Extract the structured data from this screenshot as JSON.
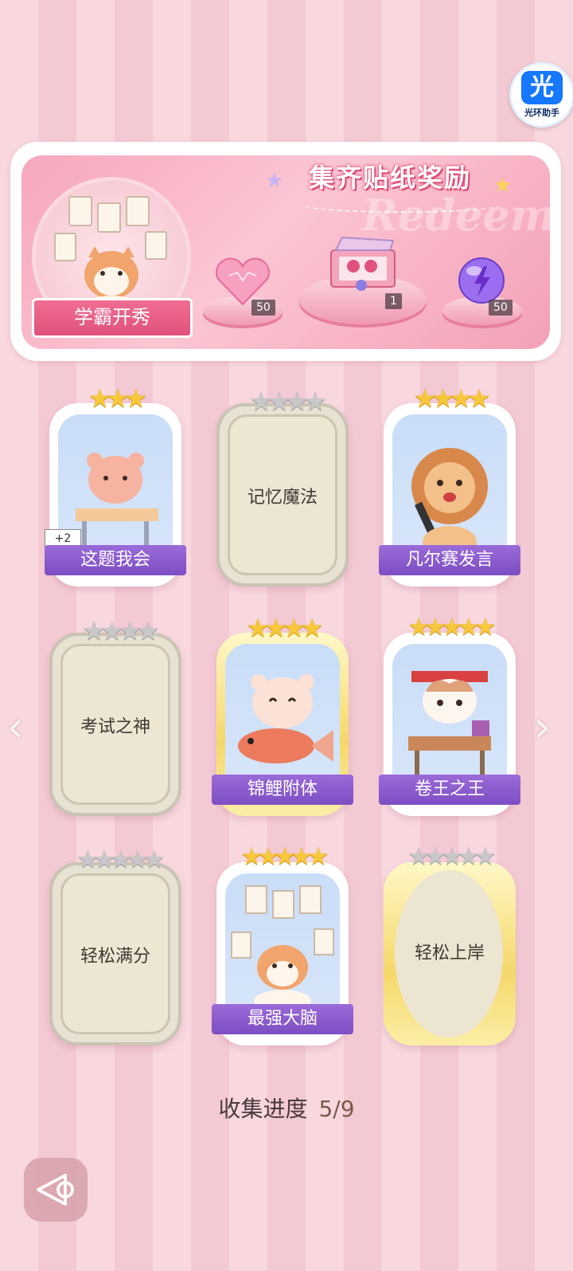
{
  "helper": {
    "glyph": "光",
    "caption": "光环助手"
  },
  "reward_panel": {
    "title": "集齐贴纸奖励",
    "watermark": "Redeem",
    "showcase_label": "学霸开秀",
    "rewards": [
      {
        "icon": "pink-heart-gem-icon",
        "count": "50"
      },
      {
        "icon": "gift-box-icon",
        "count": "1"
      },
      {
        "icon": "purple-energy-orb-icon",
        "count": "50"
      }
    ]
  },
  "cards": [
    {
      "label": "这题我会",
      "stars_total": 3,
      "stars_filled": 3,
      "unlocked": true,
      "bonus": "+2",
      "art": "bear-at-desk"
    },
    {
      "label": "记忆魔法",
      "stars_total": 4,
      "stars_filled": 0,
      "unlocked": false
    },
    {
      "label": "凡尔赛发言",
      "stars_total": 4,
      "stars_filled": 4,
      "unlocked": true,
      "art": "lion-with-mic"
    },
    {
      "label": "考试之神",
      "stars_total": 4,
      "stars_filled": 0,
      "unlocked": false
    },
    {
      "label": "锦鲤附体",
      "stars_total": 4,
      "stars_filled": 4,
      "unlocked": true,
      "gold": true,
      "art": "bear-with-koi"
    },
    {
      "label": "卷王之王",
      "stars_total": 5,
      "stars_filled": 5,
      "unlocked": true,
      "art": "cat-studying"
    },
    {
      "label": "轻松满分",
      "stars_total": 5,
      "stars_filled": 0,
      "unlocked": false
    },
    {
      "label": "最强大脑",
      "stars_total": 5,
      "stars_filled": 5,
      "unlocked": true,
      "art": "cat-with-papers"
    },
    {
      "label": "轻松上岸",
      "stars_total": 5,
      "stars_filled": 0,
      "unlocked": false,
      "gold": true
    }
  ],
  "progress": {
    "label": "收集进度",
    "value": "5/9"
  },
  "colors": {
    "accent_purple": "#8a5ccf",
    "panel_pink": "#f7a7bd",
    "star_gold": "#f7c83a"
  }
}
